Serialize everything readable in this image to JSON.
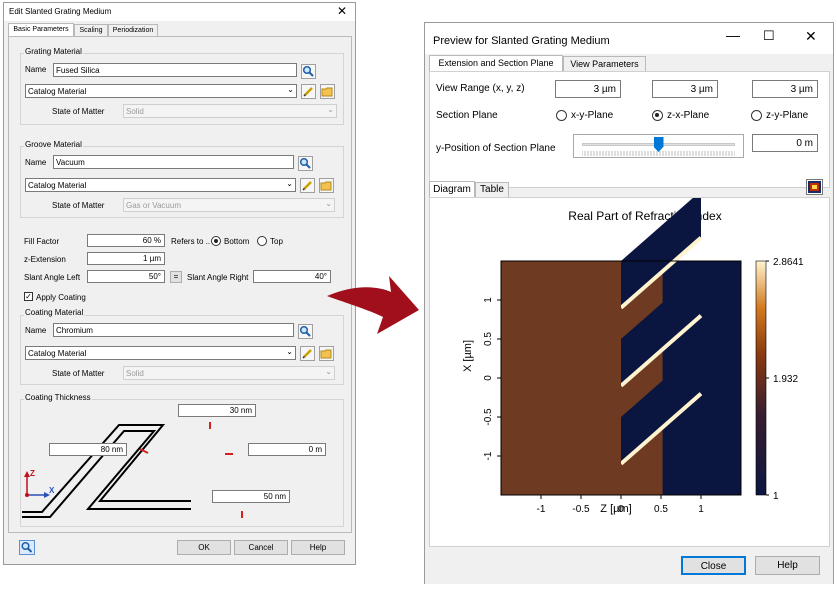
{
  "left": {
    "title": "Edit Slanted Grating Medium",
    "tabs": [
      "Basic Parameters",
      "Scaling",
      "Periodization"
    ],
    "grating": {
      "group": "Grating Material",
      "name_label": "Name",
      "name": "Fused Silica",
      "catalog": "Catalog Material",
      "state_label": "State of Matter",
      "state": "Solid"
    },
    "groove": {
      "group": "Groove Material",
      "name_label": "Name",
      "name": "Vacuum",
      "catalog": "Catalog Material",
      "state_label": "State of Matter",
      "state": "Gas or Vacuum"
    },
    "fill_factor_label": "Fill Factor",
    "fill_factor": "60 %",
    "refers_to": "Refers to ..",
    "bottom": "Bottom",
    "top": "Top",
    "z_ext_label": "z-Extension",
    "z_ext": "1 µm",
    "slant_left_label": "Slant Angle Left",
    "slant_left": "50°",
    "eq": "=",
    "slant_right_label": "Slant Angle Right",
    "slant_right": "40°",
    "apply_coating": "Apply Coating",
    "coating": {
      "group": "Coating Material",
      "name_label": "Name",
      "name": "Chromium",
      "catalog": "Catalog Material",
      "state_label": "State of Matter",
      "state": "Solid"
    },
    "thickness_group": "Coating Thickness",
    "thick_top": "30 nm",
    "thick_left": "80 nm",
    "thick_right": "0 m",
    "thick_bottom": "50 nm",
    "axis_z": "Z",
    "axis_x": "X",
    "ok": "OK",
    "cancel": "Cancel",
    "help": "Help"
  },
  "right": {
    "title": "Preview for Slanted Grating Medium",
    "tabs": [
      "Extension and Section Plane",
      "View Parameters"
    ],
    "view_range_label": "View Range (x, y, z)",
    "vr": [
      "3 µm",
      "3 µm",
      "3 µm"
    ],
    "section_label": "Section Plane",
    "planes": [
      "x-y-Plane",
      "z-x-Plane",
      "z-y-Plane"
    ],
    "ypos_label": "y-Position of Section Plane",
    "ypos": "0 m",
    "slider_fraction": 0.5,
    "diag_tabs": [
      "Diagram",
      "Table"
    ],
    "close": "Close",
    "help": "Help"
  },
  "chart_data": {
    "type": "heatmap",
    "title": "Real Part of Refractive Index",
    "xlabel": "Z [µm]",
    "ylabel": "X [µm]",
    "xlim": [
      -1.5,
      1.5
    ],
    "ylim": [
      -1.5,
      1.5
    ],
    "xticks": [
      "-1",
      "-0.5",
      "0",
      "0.5",
      "1"
    ],
    "yticks": [
      "-1",
      "-0.5",
      "0",
      "0.5",
      "1"
    ],
    "colorbar_ticks": [
      "2.8641",
      "1.932",
      "1"
    ],
    "colorbar_range": [
      1,
      2.8641
    ],
    "colors": {
      "substrate": "#6e3a22",
      "vacuum": "#0b1640",
      "coating": "#fff4cf"
    }
  },
  "colors": {
    "arrow": "#a10f1c",
    "accent": "#0078d7"
  },
  "icons": [
    "search-icon",
    "pencil-icon",
    "folder-icon",
    "close-icon",
    "minimize-icon",
    "maximize-icon",
    "colormap-icon"
  ]
}
